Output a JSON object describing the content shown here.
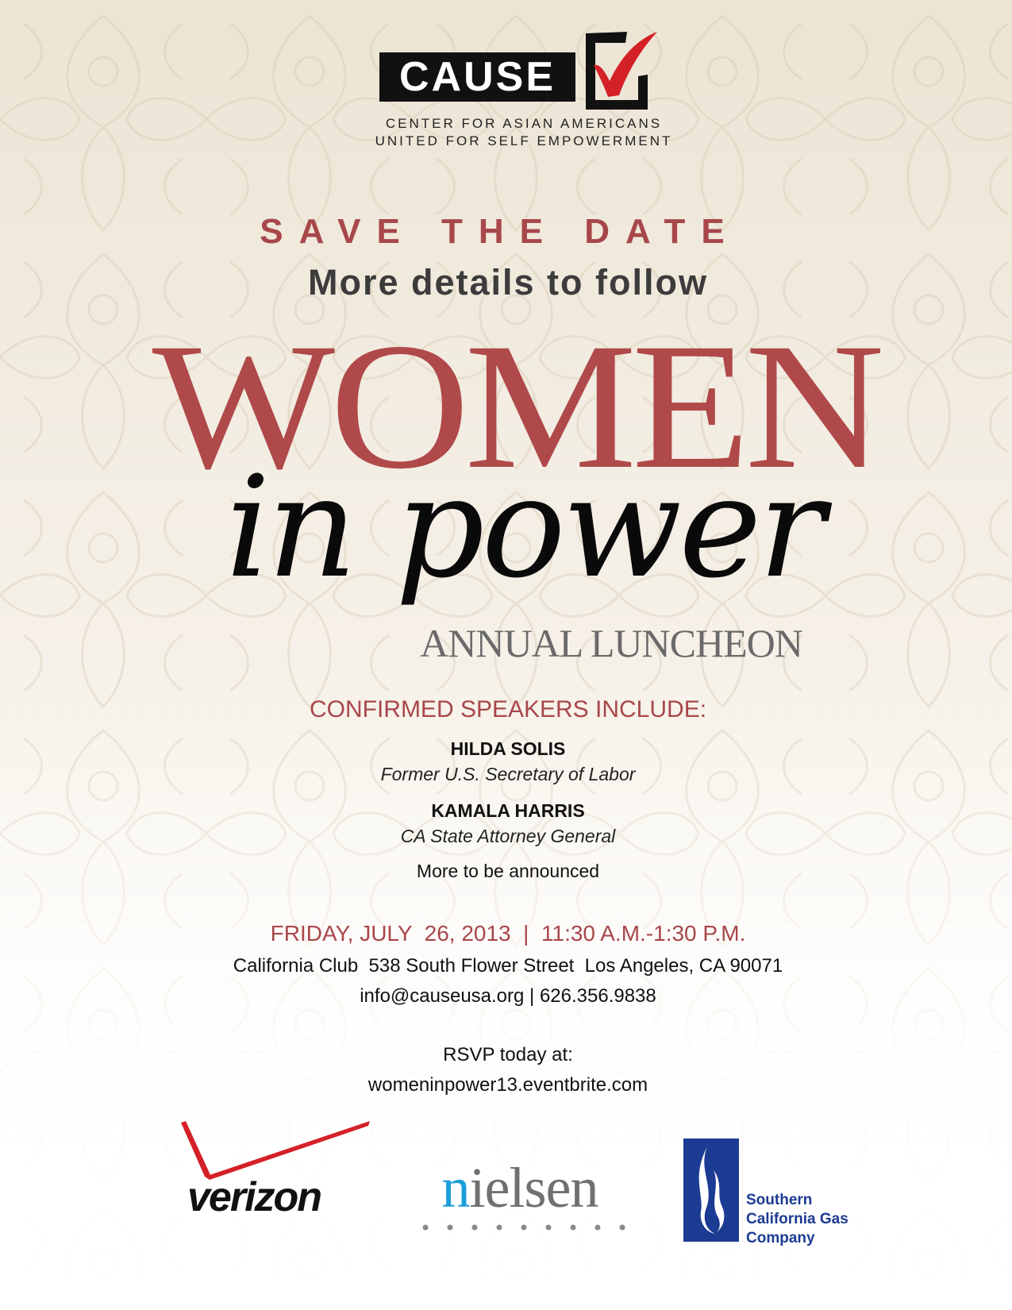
{
  "organization": {
    "logo_word": "CAUSE",
    "line1": "CENTER FOR ASIAN AMERICANS",
    "line2": "UNITED FOR SELF EMPOWERMENT"
  },
  "headline": {
    "save_the_date": "SAVE THE DATE",
    "subtitle": "More details to follow",
    "title_word1": "WOMEN",
    "title_word2": "in power",
    "event_type": "ANNUAL LUNCHEON"
  },
  "speakers": {
    "heading": "CONFIRMED SPEAKERS INCLUDE:",
    "list": [
      {
        "name": "HILDA SOLIS",
        "title": "Former U.S. Secretary of Labor"
      },
      {
        "name": "KAMALA HARRIS",
        "title": "CA State Attorney General"
      }
    ],
    "more": "More to be announced"
  },
  "event": {
    "datetime": "FRIDAY, JULY  26, 2013  |  11:30 A.M.-1:30 P.M.",
    "venue": "California Club  538 South Flower Street  Los Angeles, CA 90071",
    "contact": "info@causeusa.org | 626.356.9838",
    "rsvp_label": "RSVP today at:",
    "rsvp_url": "womeninpower13.eventbrite.com"
  },
  "sponsors": {
    "verizon": "verizon",
    "nielsen": "nielsen",
    "socalgas": "Southern California Gas Company"
  },
  "colors": {
    "accent_red": "#a8474b",
    "logo_check_red": "#d42027",
    "nielsen_blue": "#1a9ed9",
    "socalgas_blue": "#1c3b93",
    "background": "#efe8da"
  }
}
